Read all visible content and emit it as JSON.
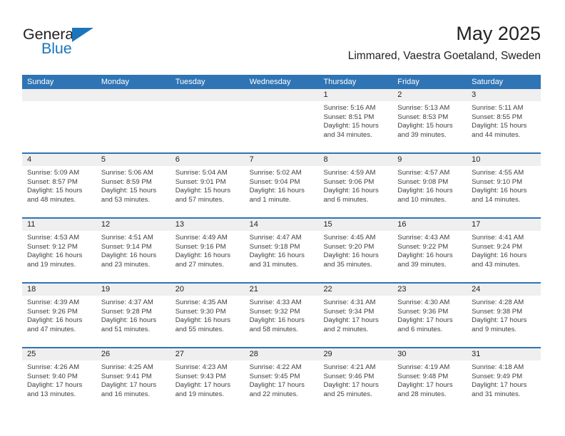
{
  "brand": {
    "name_part1": "General",
    "name_part2": "Blue",
    "accent_color": "#1b75bb",
    "triangle_icon": "brand-triangle-icon"
  },
  "header": {
    "title": "May 2025",
    "subtitle": "Limmared, Vaestra Goetaland, Sweden",
    "header_bar_color": "#2f74b5"
  },
  "weekdays": [
    "Sunday",
    "Monday",
    "Tuesday",
    "Wednesday",
    "Thursday",
    "Friday",
    "Saturday"
  ],
  "weeks": [
    [
      {
        "day": "",
        "lines": []
      },
      {
        "day": "",
        "lines": []
      },
      {
        "day": "",
        "lines": []
      },
      {
        "day": "",
        "lines": []
      },
      {
        "day": "1",
        "lines": [
          "Sunrise: 5:16 AM",
          "Sunset: 8:51 PM",
          "Daylight: 15 hours",
          "and 34 minutes."
        ]
      },
      {
        "day": "2",
        "lines": [
          "Sunrise: 5:13 AM",
          "Sunset: 8:53 PM",
          "Daylight: 15 hours",
          "and 39 minutes."
        ]
      },
      {
        "day": "3",
        "lines": [
          "Sunrise: 5:11 AM",
          "Sunset: 8:55 PM",
          "Daylight: 15 hours",
          "and 44 minutes."
        ]
      }
    ],
    [
      {
        "day": "4",
        "lines": [
          "Sunrise: 5:09 AM",
          "Sunset: 8:57 PM",
          "Daylight: 15 hours",
          "and 48 minutes."
        ]
      },
      {
        "day": "5",
        "lines": [
          "Sunrise: 5:06 AM",
          "Sunset: 8:59 PM",
          "Daylight: 15 hours",
          "and 53 minutes."
        ]
      },
      {
        "day": "6",
        "lines": [
          "Sunrise: 5:04 AM",
          "Sunset: 9:01 PM",
          "Daylight: 15 hours",
          "and 57 minutes."
        ]
      },
      {
        "day": "7",
        "lines": [
          "Sunrise: 5:02 AM",
          "Sunset: 9:04 PM",
          "Daylight: 16 hours",
          "and 1 minute."
        ]
      },
      {
        "day": "8",
        "lines": [
          "Sunrise: 4:59 AM",
          "Sunset: 9:06 PM",
          "Daylight: 16 hours",
          "and 6 minutes."
        ]
      },
      {
        "day": "9",
        "lines": [
          "Sunrise: 4:57 AM",
          "Sunset: 9:08 PM",
          "Daylight: 16 hours",
          "and 10 minutes."
        ]
      },
      {
        "day": "10",
        "lines": [
          "Sunrise: 4:55 AM",
          "Sunset: 9:10 PM",
          "Daylight: 16 hours",
          "and 14 minutes."
        ]
      }
    ],
    [
      {
        "day": "11",
        "lines": [
          "Sunrise: 4:53 AM",
          "Sunset: 9:12 PM",
          "Daylight: 16 hours",
          "and 19 minutes."
        ]
      },
      {
        "day": "12",
        "lines": [
          "Sunrise: 4:51 AM",
          "Sunset: 9:14 PM",
          "Daylight: 16 hours",
          "and 23 minutes."
        ]
      },
      {
        "day": "13",
        "lines": [
          "Sunrise: 4:49 AM",
          "Sunset: 9:16 PM",
          "Daylight: 16 hours",
          "and 27 minutes."
        ]
      },
      {
        "day": "14",
        "lines": [
          "Sunrise: 4:47 AM",
          "Sunset: 9:18 PM",
          "Daylight: 16 hours",
          "and 31 minutes."
        ]
      },
      {
        "day": "15",
        "lines": [
          "Sunrise: 4:45 AM",
          "Sunset: 9:20 PM",
          "Daylight: 16 hours",
          "and 35 minutes."
        ]
      },
      {
        "day": "16",
        "lines": [
          "Sunrise: 4:43 AM",
          "Sunset: 9:22 PM",
          "Daylight: 16 hours",
          "and 39 minutes."
        ]
      },
      {
        "day": "17",
        "lines": [
          "Sunrise: 4:41 AM",
          "Sunset: 9:24 PM",
          "Daylight: 16 hours",
          "and 43 minutes."
        ]
      }
    ],
    [
      {
        "day": "18",
        "lines": [
          "Sunrise: 4:39 AM",
          "Sunset: 9:26 PM",
          "Daylight: 16 hours",
          "and 47 minutes."
        ]
      },
      {
        "day": "19",
        "lines": [
          "Sunrise: 4:37 AM",
          "Sunset: 9:28 PM",
          "Daylight: 16 hours",
          "and 51 minutes."
        ]
      },
      {
        "day": "20",
        "lines": [
          "Sunrise: 4:35 AM",
          "Sunset: 9:30 PM",
          "Daylight: 16 hours",
          "and 55 minutes."
        ]
      },
      {
        "day": "21",
        "lines": [
          "Sunrise: 4:33 AM",
          "Sunset: 9:32 PM",
          "Daylight: 16 hours",
          "and 58 minutes."
        ]
      },
      {
        "day": "22",
        "lines": [
          "Sunrise: 4:31 AM",
          "Sunset: 9:34 PM",
          "Daylight: 17 hours",
          "and 2 minutes."
        ]
      },
      {
        "day": "23",
        "lines": [
          "Sunrise: 4:30 AM",
          "Sunset: 9:36 PM",
          "Daylight: 17 hours",
          "and 6 minutes."
        ]
      },
      {
        "day": "24",
        "lines": [
          "Sunrise: 4:28 AM",
          "Sunset: 9:38 PM",
          "Daylight: 17 hours",
          "and 9 minutes."
        ]
      }
    ],
    [
      {
        "day": "25",
        "lines": [
          "Sunrise: 4:26 AM",
          "Sunset: 9:40 PM",
          "Daylight: 17 hours",
          "and 13 minutes."
        ]
      },
      {
        "day": "26",
        "lines": [
          "Sunrise: 4:25 AM",
          "Sunset: 9:41 PM",
          "Daylight: 17 hours",
          "and 16 minutes."
        ]
      },
      {
        "day": "27",
        "lines": [
          "Sunrise: 4:23 AM",
          "Sunset: 9:43 PM",
          "Daylight: 17 hours",
          "and 19 minutes."
        ]
      },
      {
        "day": "28",
        "lines": [
          "Sunrise: 4:22 AM",
          "Sunset: 9:45 PM",
          "Daylight: 17 hours",
          "and 22 minutes."
        ]
      },
      {
        "day": "29",
        "lines": [
          "Sunrise: 4:21 AM",
          "Sunset: 9:46 PM",
          "Daylight: 17 hours",
          "and 25 minutes."
        ]
      },
      {
        "day": "30",
        "lines": [
          "Sunrise: 4:19 AM",
          "Sunset: 9:48 PM",
          "Daylight: 17 hours",
          "and 28 minutes."
        ]
      },
      {
        "day": "31",
        "lines": [
          "Sunrise: 4:18 AM",
          "Sunset: 9:49 PM",
          "Daylight: 17 hours",
          "and 31 minutes."
        ]
      }
    ]
  ]
}
